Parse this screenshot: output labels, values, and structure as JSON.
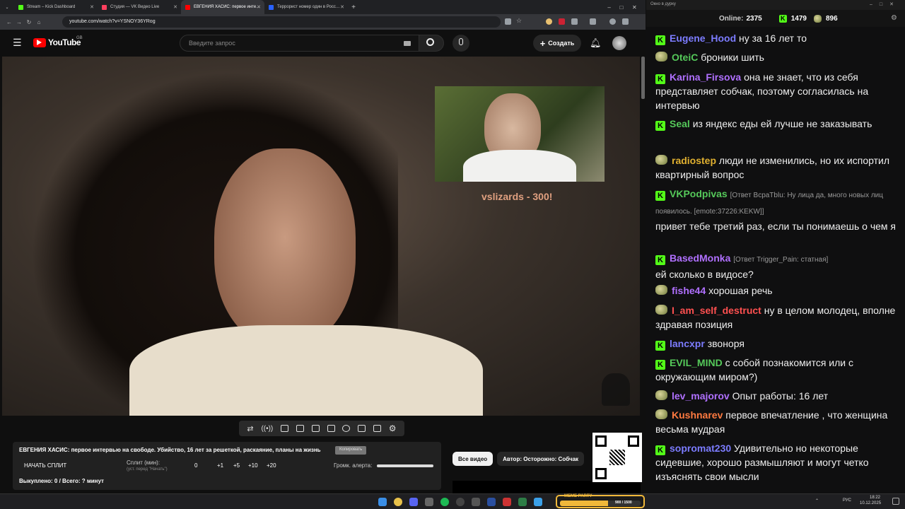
{
  "browser": {
    "tabs": [
      {
        "title": "Stream – Kick Dashboard",
        "color": "#53fc18"
      },
      {
        "title": "Студия — VK Видео Live",
        "color": "#ff3f5e"
      },
      {
        "title": "ЕВГЕНИЯ ХАСИС: первое инте…",
        "color": "#ff0000"
      },
      {
        "title": "Террорист номер один в Росс…",
        "color": "#2962ff"
      }
    ],
    "url": "youtube.com/watch?v=YSNOY36YRog"
  },
  "youtube": {
    "logo": "YouTube",
    "region": "GB",
    "search_placeholder": "Введите запрос",
    "create_label": "Создать"
  },
  "video": {
    "overlay_text": "vslizards - 300!"
  },
  "panel": {
    "title": "ЕВГЕНИЯ ХАСИС: первое интервью на свободе. Убийство, 16 лет за решеткой, раскаяние, планы на жизнь",
    "copy_label": "Копировать",
    "start_split": "НАЧАТЬ СПЛИТ",
    "split_label": "Сплит (мин):",
    "split_hint": "(уст. перед \"Начать\")",
    "split_value": "0",
    "steps": [
      "+1",
      "+5",
      "+10",
      "+20"
    ],
    "volume_label": "Громк. алерта:",
    "volume_level": 1.0,
    "bought": "Выкуплено: 0 / Всего: ? минут"
  },
  "chips": {
    "all": "Все видео",
    "author": "Автор: Осторожно: Собчак"
  },
  "chat": {
    "window_title": "Окно в дурку",
    "online_label": "Online:",
    "online_count": "2375",
    "kick_count": "1479",
    "vk_count": "896",
    "messages": [
      {
        "user": "Eugene_Hood",
        "color": "#7c7cff",
        "badge": "kick",
        "text": "ну за 16 лет то"
      },
      {
        "user": "OteiC",
        "color": "#55c95a",
        "badge": "emote",
        "text": "броники шить"
      },
      {
        "user": "Karina_Firsova",
        "color": "#b070ff",
        "badge": "kick",
        "text": "она не знает, что из себя представляет собчак, поэтому согласилась на интервью"
      },
      {
        "user": "Seal",
        "color": "#55c95a",
        "badge": "kick",
        "text": "из яндекс еды ей лучше не заказывать"
      },
      {
        "user": "radiostep",
        "color": "#e0b030",
        "badge": "emote",
        "text": "люди не изменились, но их испортил квартирный вопрос"
      },
      {
        "user": "VKPodpivas",
        "color": "#55c95a",
        "badge": "kick",
        "reply": "[Ответ ВсраTblu: Ну лица да, много новых лиц появилось. [emote:37226:KEKW]]",
        "text": "привет тебе третий раз, если ты понимаешь о чем я"
      },
      {
        "user": "BasedMonka",
        "color": "#b070ff",
        "badge": "kick",
        "reply": "[Ответ Trigger_Pain: статная]",
        "text": "ей сколько в видосе?"
      },
      {
        "user": "fishe44",
        "color": "#b070ff",
        "badge": "emote",
        "text": "хорошая речь"
      },
      {
        "user": "I_am_self_destruct",
        "color": "#ff5050",
        "badge": "emote",
        "text": "ну в целом молодец, вполне здравая позиция"
      },
      {
        "user": "lancxpr",
        "color": "#7c7cff",
        "badge": "kick",
        "text": "звоноря"
      },
      {
        "user": "EVIL_MIND",
        "color": "#55c95a",
        "badge": "kick",
        "text": "с собой познакомится или с окружающим миром?)"
      },
      {
        "user": "lev_majorov",
        "color": "#b070ff",
        "badge": "emote",
        "text": "Опыт работы: 16 лет"
      },
      {
        "user": "Kushnarev",
        "color": "#ff7a40",
        "badge": "emote",
        "text": "первое впечатление , что женщина весьма мудрая"
      },
      {
        "user": "sopromat230",
        "color": "#7c7cff",
        "badge": "kick",
        "text": "Удивительно но некоторые сидевшие, хорошо размышляют и могут четко изъяснять свои мысли"
      }
    ]
  },
  "widget": {
    "title": "MEME PARTY",
    "progress_text": "900 / 1500",
    "progress": 0.6
  },
  "taskbar": {
    "lang": "РУС",
    "time": "18:22",
    "date": "10.12.2025"
  }
}
